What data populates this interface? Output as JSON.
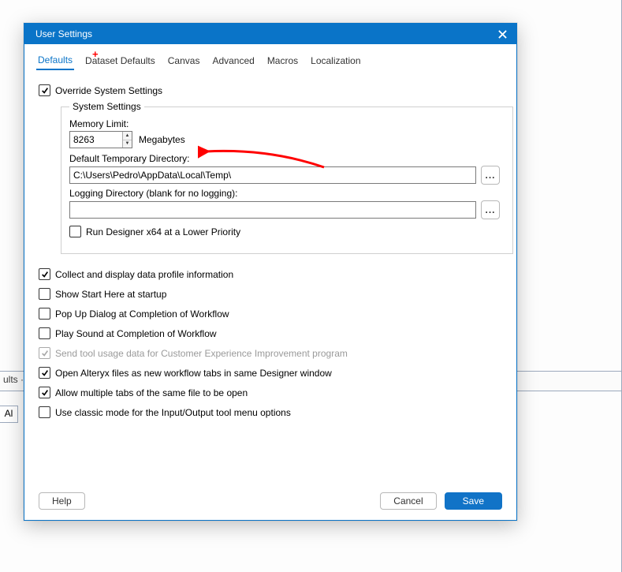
{
  "bg": {
    "ults_label": "ults ·",
    "tab_label": "Al"
  },
  "dialog": {
    "title": "User Settings",
    "tabs": [
      "Defaults",
      "Dataset Defaults",
      "Canvas",
      "Advanced",
      "Macros",
      "Localization"
    ],
    "active_tab_index": 0,
    "override_label": "Override System Settings",
    "override_checked": true,
    "group_legend": "System Settings",
    "memory": {
      "label": "Memory Limit:",
      "value": "8263",
      "unit": "Megabytes"
    },
    "temp_dir": {
      "label": "Default Temporary Directory:",
      "value": "C:\\Users\\Pedro\\AppData\\Local\\Temp\\",
      "browse": "..."
    },
    "log_dir": {
      "label": "Logging Directory (blank for no logging):",
      "value": "",
      "browse": "..."
    },
    "run_lower": {
      "label": "Run Designer x64 at a Lower Priority",
      "checked": false
    },
    "checks": [
      {
        "label": "Collect and display data profile information",
        "checked": true,
        "disabled": false
      },
      {
        "label": "Show Start Here at startup",
        "checked": false,
        "disabled": false
      },
      {
        "label": "Pop Up Dialog at Completion of Workflow",
        "checked": false,
        "disabled": false
      },
      {
        "label": "Play Sound at Completion of Workflow",
        "checked": false,
        "disabled": false
      },
      {
        "label": "Send tool usage data for Customer Experience Improvement program",
        "checked": true,
        "disabled": true
      },
      {
        "label": "Open Alteryx files as new workflow tabs in same Designer window",
        "checked": true,
        "disabled": false
      },
      {
        "label": "Allow multiple tabs of the same file to be open",
        "checked": true,
        "disabled": false
      },
      {
        "label": "Use classic mode for the Input/Output tool menu options",
        "checked": false,
        "disabled": false
      }
    ],
    "buttons": {
      "help": "Help",
      "cancel": "Cancel",
      "save": "Save"
    }
  }
}
